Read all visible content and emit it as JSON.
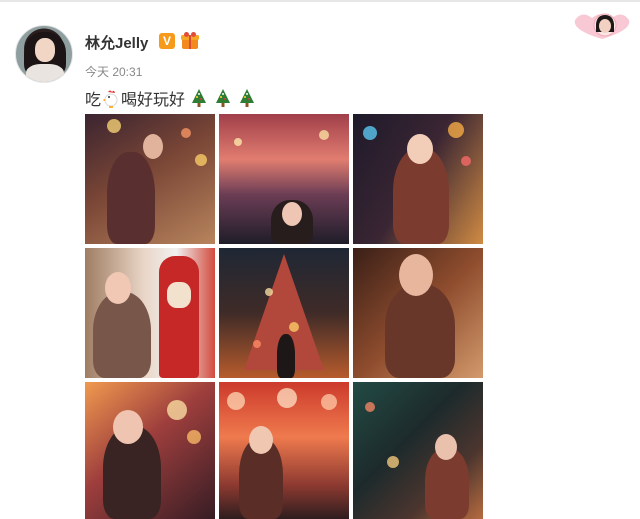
{
  "post": {
    "author": "林允Jelly",
    "verified_badge": "V",
    "time": "今天 20:31",
    "text_before": "吃",
    "text_after": "喝好玩好"
  },
  "icons": {
    "avatar": "user-avatar",
    "gift": "gift-badge-icon",
    "rooster": "rooster-emoji-icon",
    "tree": "christmas-tree-emoji-icon",
    "corner": "heart-avatar-icon"
  },
  "photos": [
    {
      "name": "photo-1"
    },
    {
      "name": "photo-2"
    },
    {
      "name": "photo-3"
    },
    {
      "name": "photo-4"
    },
    {
      "name": "photo-5"
    },
    {
      "name": "photo-6"
    },
    {
      "name": "photo-7"
    },
    {
      "name": "photo-8"
    },
    {
      "name": "photo-9"
    }
  ],
  "colors": {
    "name_text": "#333333",
    "time_text": "#888888",
    "verified": "#f59a1a"
  }
}
